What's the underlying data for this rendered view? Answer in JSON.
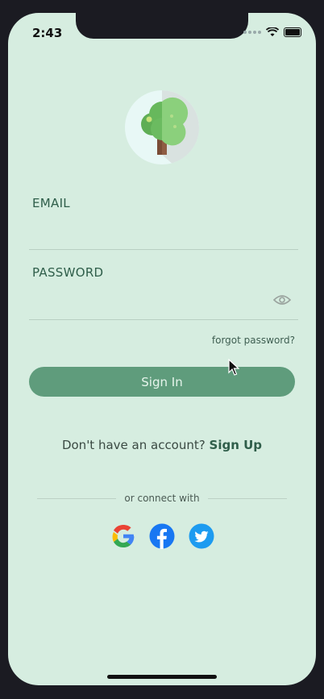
{
  "status_bar": {
    "time": "2:43"
  },
  "form": {
    "email_label": "EMAIL",
    "email_value": "",
    "password_label": "PASSWORD",
    "password_value": "",
    "forgot_label": "forgot password?",
    "signin_label": "Sign In"
  },
  "signup": {
    "prompt": "Don't have an account?",
    "link": "Sign Up"
  },
  "social": {
    "connect_text": "or connect with",
    "providers": [
      "google-icon",
      "facebook-icon",
      "twitter-icon"
    ]
  },
  "colors": {
    "background": "#d6ede0",
    "primary": "#5f9c7c",
    "label": "#2f5e4a",
    "facebook": "#1877f2",
    "twitter": "#1d9bf0"
  }
}
